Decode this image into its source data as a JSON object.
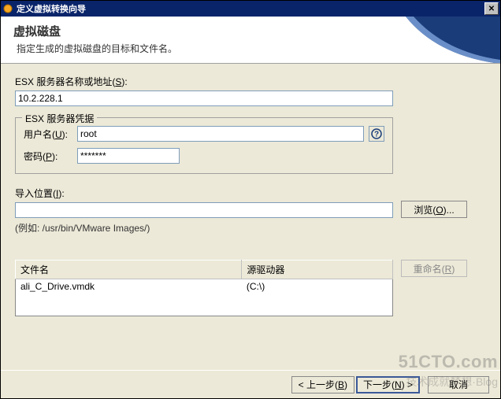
{
  "titlebar": {
    "title": "定义虚拟转换向导",
    "close_label": "✕"
  },
  "header": {
    "title": "虚拟磁盘",
    "subtitle": "指定生成的虚拟磁盘的目标和文件名。"
  },
  "esx": {
    "label_prefix": "ESX 服务器名称或地址(",
    "label_key": "S",
    "label_suffix": "):",
    "value": "10.2.228.1"
  },
  "creds": {
    "legend": "ESX 服务器凭据",
    "user_label_prefix": "用户名(",
    "user_label_key": "U",
    "user_label_suffix": "):",
    "user_value": "root",
    "pass_label_prefix": "密码(",
    "pass_label_key": "P",
    "pass_label_suffix": "):",
    "pass_value": "*******",
    "help_symbol": "?"
  },
  "import": {
    "label_prefix": "导入位置(",
    "label_key": "I",
    "label_suffix": "):",
    "value": "",
    "browse_prefix": "浏览(",
    "browse_key": "O",
    "browse_suffix": ")...",
    "hint": "(例如: /usr/bin/VMware Images/)"
  },
  "table": {
    "col_file": "文件名",
    "col_drive": "源驱动器",
    "rows": [
      {
        "file": "ali_C_Drive.vmdk",
        "drive": "(C:\\)"
      }
    ],
    "rename_prefix": "重命名(",
    "rename_key": "R",
    "rename_suffix": ")"
  },
  "footer": {
    "back_prefix": "< 上一步(",
    "back_key": "B",
    "back_suffix": ")",
    "next_prefix": "下一步(",
    "next_key": "N",
    "next_suffix": ") >",
    "cancel": "取消"
  },
  "watermark": {
    "main": "51CTO.com",
    "sub": "技术成就梦想·Blog"
  }
}
